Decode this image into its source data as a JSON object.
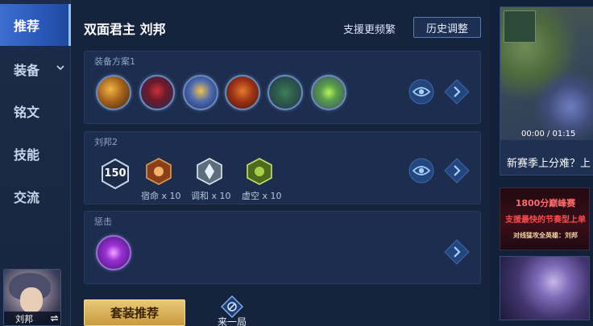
{
  "sidebar": {
    "items": [
      {
        "label": "推荐",
        "active": true
      },
      {
        "label": "装备",
        "active": false
      },
      {
        "label": "铭文",
        "active": false
      },
      {
        "label": "技能",
        "active": false
      },
      {
        "label": "交流",
        "active": false
      }
    ],
    "hero_card": {
      "name": "刘邦",
      "swap_icon": "swap-icon"
    }
  },
  "header": {
    "hero_title": "双面君主 刘邦",
    "support_link": "支援更频繁",
    "history_button": "历史调整"
  },
  "panels": {
    "equipment": {
      "label": "装备方案1",
      "items": [
        "equip-1",
        "equip-2",
        "equip-3",
        "equip-4",
        "equip-5",
        "equip-6"
      ]
    },
    "runes": {
      "label": "刘邦2",
      "level": "150",
      "items": [
        {
          "label": "宿命 x 10",
          "color": "#c8742e"
        },
        {
          "label": "调和 x 10",
          "color": "#b6c7d6"
        },
        {
          "label": "虚空 x 10",
          "color": "#8fb23a"
        }
      ]
    },
    "skill": {
      "label": "惩击"
    }
  },
  "bottom": {
    "suit_button": "套装推荐",
    "again_label": "来一局"
  },
  "right": {
    "video": {
      "time": "00:00 / 01:15",
      "title": "新赛季上分难？上"
    },
    "promo": {
      "line1": "1800分巅峰赛",
      "line2": "支援最快的节奏型上单",
      "line3": "对线猛攻全英雄：刘邦"
    }
  },
  "colors": {
    "accent_gold": "#e0b862",
    "active_tab": "#3b6fd0",
    "panel_bg": "#1c2d4d"
  }
}
